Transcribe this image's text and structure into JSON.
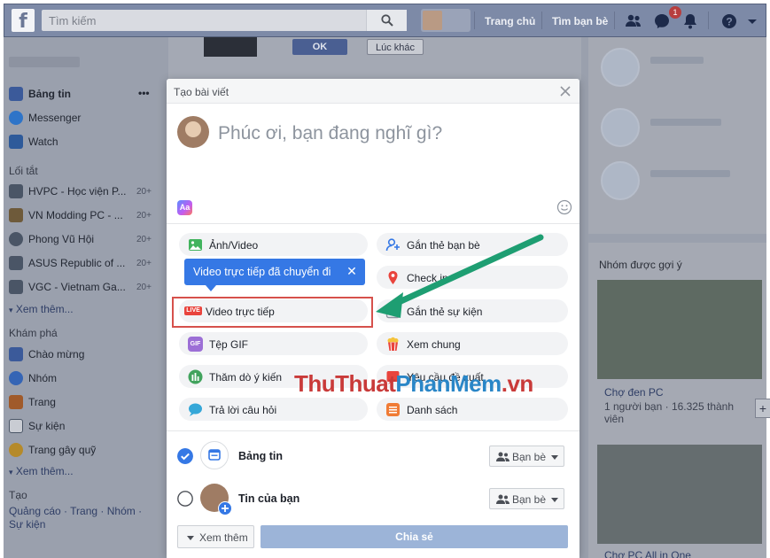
{
  "topbar": {
    "search_placeholder": "Tìm kiếm",
    "nav_home": "Trang chủ",
    "nav_find_friends": "Tìm bạn bè",
    "notification_count": "1"
  },
  "sidebar": {
    "news_feed": "Bảng tin",
    "messenger": "Messenger",
    "watch": "Watch",
    "shortcuts_heading": "Lối tắt",
    "shortcuts": [
      {
        "label": "HVPC - Học viện P...",
        "count": "20+"
      },
      {
        "label": "VN Modding PC - ...",
        "count": "20+"
      },
      {
        "label": "Phong Vũ Hội",
        "count": "20+"
      },
      {
        "label": "ASUS Republic of ...",
        "count": "20+"
      },
      {
        "label": "VGC - Vietnam Ga...",
        "count": "20+"
      }
    ],
    "see_more": "Xem thêm...",
    "explore_heading": "Khám phá",
    "explore": [
      "Chào mừng",
      "Nhóm",
      "Trang",
      "Sự kiện",
      "Trang gây quỹ"
    ],
    "see_more_2": "Xem thêm...",
    "create_heading": "Tạo",
    "create_links": "Quảng cáo · Trang · Nhóm · Sự kiện"
  },
  "feed": {
    "ok_label": "OK",
    "other_label": "Lúc khác"
  },
  "rightcol": {
    "groups_title": "Nhóm được gợi ý",
    "group1_name": "Chợ đen PC",
    "group1_meta": "1 người bạn · 16.325 thành viên",
    "group2_name": "Chợ PC All in One",
    "plus": "+"
  },
  "modal": {
    "title": "Tạo bài viết",
    "placeholder": "Phúc ơi, bạn đang nghĩ gì?",
    "bg_icon_text": "Aa",
    "options": [
      {
        "label": "Ảnh/Video",
        "icon": "photo-icon"
      },
      {
        "label": "Gắn thẻ bạn bè",
        "icon": "tag-friends-icon"
      },
      {
        "label": "Check in",
        "icon": "location-pin-icon"
      },
      {
        "label": "Video trực tiếp",
        "icon": "live-icon"
      },
      {
        "label": "Gắn thẻ sự kiện",
        "icon": "calendar-icon"
      },
      {
        "label": "Tệp GIF",
        "icon": "gif-icon"
      },
      {
        "label": "Xem chung",
        "icon": "popcorn-icon"
      },
      {
        "label": "Thăm dò ý kiến",
        "icon": "poll-icon"
      },
      {
        "label": "Yêu cầu đề xuất",
        "icon": "recommendation-icon"
      },
      {
        "label": "Trả lời câu hỏi",
        "icon": "question-bubble-icon"
      },
      {
        "label": "Danh sách",
        "icon": "list-icon"
      }
    ],
    "live_badge": "LIVE",
    "gif_badge": "GIF",
    "tooltip_text": "Video trực tiếp đã chuyển đi",
    "tooltip_close": "✕",
    "dest_newsfeed": "Bảng tin",
    "dest_story": "Tin của bạn",
    "audience_label": "Bạn bè",
    "see_more": "Xem thêm",
    "share": "Chia sẻ"
  },
  "watermark": {
    "part1": "ThuThuat",
    "part2": "PhanMem",
    "part3": ".vn"
  },
  "colors": {
    "accent": "#3578e5",
    "highlight_box": "#d6514c",
    "arrow": "#1e9e72",
    "share_disabled": "#9cb4d8"
  }
}
